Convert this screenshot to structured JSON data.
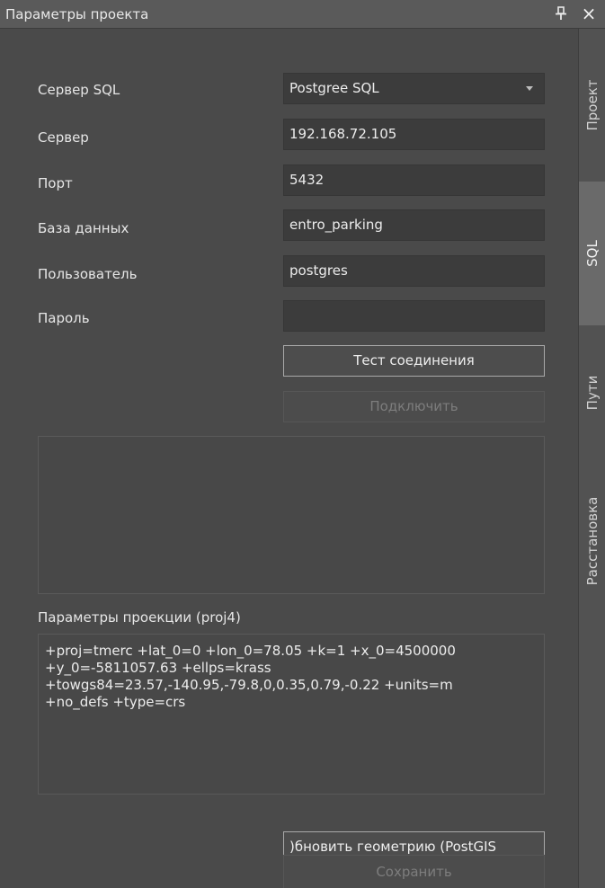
{
  "window": {
    "title": "Параметры проекта",
    "pin_glyph": "pin-icon",
    "close_glyph": "×"
  },
  "form": {
    "sql_server": {
      "label": "Сервер SQL",
      "value": "Postgree SQL"
    },
    "server": {
      "label": "Сервер",
      "value": "192.168.72.105"
    },
    "port": {
      "label": "Порт",
      "value": "5432"
    },
    "database": {
      "label": "База данных",
      "value": "entro_parking"
    },
    "user": {
      "label": "Пользователь",
      "value": "postgres"
    },
    "password": {
      "label": "Пароль",
      "value": ""
    }
  },
  "buttons": {
    "test_connection": "Тест соединения",
    "connect": "Подключить",
    "update_geometry": ")бновить геометрию (PostGIS",
    "save": "Сохранить"
  },
  "projection": {
    "label": "Параметры проекции (proj4)",
    "text": "+proj=tmerc +lat_0=0 +lon_0=78.05 +k=1 +x_0=4500000\n+y_0=-5811057.63 +ellps=krass\n+towgs84=23.57,-140.95,-79.8,0,0.35,0.79,-0.22 +units=m\n+no_defs +type=crs"
  },
  "tabs": [
    {
      "label": "Проект",
      "active": false
    },
    {
      "label": "SQL",
      "active": true
    },
    {
      "label": "Пути",
      "active": false
    },
    {
      "label": "Расстановка",
      "active": false
    }
  ],
  "colors": {
    "background": "#4a4a4a",
    "titlebar": "#5a5a5a",
    "field": "#3c3c3c",
    "active_tab": "#6a6a6a"
  }
}
